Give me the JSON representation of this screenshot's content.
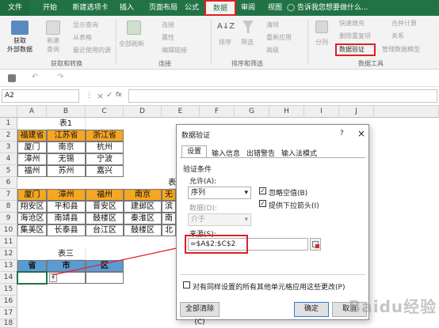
{
  "ribbon_tabs": [
    "文件",
    "开始",
    "新建选项卡",
    "插入",
    "页面布局",
    "公式",
    "数据",
    "审阅",
    "视图"
  ],
  "active_tab": "数据",
  "tell_me": "告诉我您想要做什么...",
  "ribbon": {
    "get_external": "获取\n外部数据",
    "new_query": "新建\n查询",
    "show_queries": "显示查询",
    "from_table": "从表格",
    "recent_sources": "最近使用的源",
    "group_get_transform": "获取和转换",
    "refresh_all": "全部刷新",
    "connections": "连接",
    "properties": "属性",
    "edit_links": "编辑链接",
    "group_connections": "连接",
    "sort": "排序",
    "filter": "筛选",
    "clear": "清除",
    "reapply": "重新应用",
    "advanced": "高级",
    "group_sort_filter": "排序和筛选",
    "text_to_columns": "分列",
    "flash_fill": "快速填充",
    "remove_duplicates": "删除重复项",
    "data_validation": "数据验证",
    "consolidate": "合并计算",
    "relationships": "关系",
    "manage_data_model": "管理数据模型",
    "group_data_tools": "数据工具"
  },
  "name_box": "A2",
  "fx": "fx",
  "columns": [
    "A",
    "B",
    "C",
    "D",
    "E",
    "F",
    "G",
    "H",
    "I",
    "J"
  ],
  "rows": [
    "1",
    "2",
    "3",
    "4",
    "5",
    "6",
    "7",
    "8",
    "9",
    "10",
    "11",
    "12",
    "13",
    "14",
    "15",
    "16",
    "17",
    "18"
  ],
  "table1": {
    "title": "表1",
    "headers": [
      "福建省",
      "江苏省",
      "浙江省"
    ],
    "rows": [
      [
        "厦门",
        "南京",
        "杭州"
      ],
      [
        "漳州",
        "无锡",
        "宁波"
      ],
      [
        "福州",
        "苏州",
        "嘉兴"
      ]
    ]
  },
  "table2": {
    "title_partial": "表",
    "headers": [
      "厦门",
      "漳州",
      "福州",
      "南京"
    ],
    "rows": [
      [
        "翔安区",
        "平和县",
        "晋安区",
        "建邺区"
      ],
      [
        "海沧区",
        "南靖县",
        "鼓楼区",
        "秦淮区"
      ],
      [
        "集美区",
        "长泰县",
        "台江区",
        "鼓楼区"
      ]
    ],
    "col_e_partial": [
      "滨",
      "南",
      "北"
    ],
    "col_e_header_partial": "无"
  },
  "table3": {
    "title": "表三",
    "headers": [
      "省",
      "市",
      "区"
    ]
  },
  "dialog": {
    "title": "数据验证",
    "help": "?",
    "close": "×",
    "tabs": [
      "设置",
      "输入信息",
      "出错警告",
      "输入法模式"
    ],
    "criteria_label": "验证条件",
    "allow_label": "允许(A):",
    "allow_value": "序列",
    "ignore_blank": "忽略空值(B)",
    "in_cell_dropdown": "提供下拉箭头(I)",
    "data_label": "数据(D):",
    "data_value": "介于",
    "source_label": "来源(S):",
    "source_value": "=$A$2:$C$2",
    "apply_all": "对有同样设置的所有其他单元格应用这些更改(P)",
    "clear_all": "全部清除(C)",
    "ok": "确定",
    "cancel": "取消"
  },
  "watermark": "Baidu经验",
  "colors": {
    "excel_green": "#217346",
    "header_orange": "#f5a623",
    "header_blue": "#5b9bd5",
    "highlight_red": "#e02020"
  }
}
